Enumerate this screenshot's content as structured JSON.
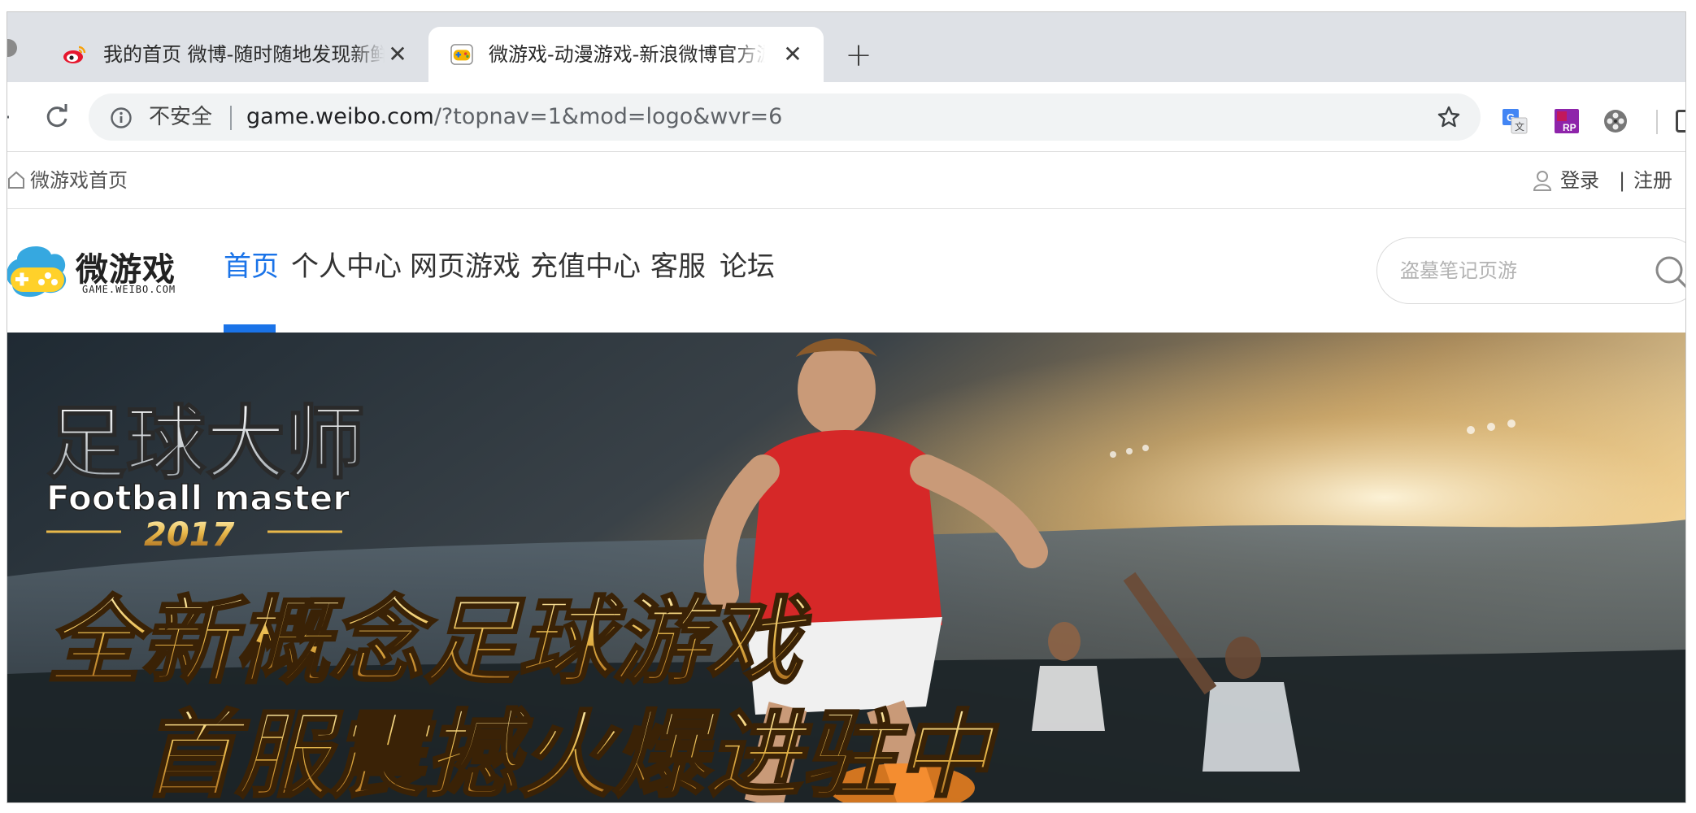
{
  "browser": {
    "tabs": [
      {
        "title": "我的首页 微博-随时随地发现新鲜事",
        "favicon": "weibo-favicon-icon",
        "active": false
      },
      {
        "title": "微游戏-动漫游戏-新浪微博官方游戏平台",
        "favicon": "weibo-game-favicon-icon",
        "active": true
      }
    ],
    "new_tab_symbol": "+",
    "close_symbol": "✕",
    "address": {
      "security_label": "不安全",
      "url_host": "game.weibo.com",
      "url_path": "/?topnav=1&mod=logo&wvr=6"
    },
    "extensions": [
      "translate-extension-icon",
      "rp-extension-icon",
      "film-reel-extension-icon",
      "extension-icon"
    ]
  },
  "topbar": {
    "home_label": "微游戏首页",
    "login_label": "登录",
    "separator": "|",
    "register_label": "注册"
  },
  "logo": {
    "cn": "微游戏",
    "en": "GAME.WEIBO.COM"
  },
  "nav": {
    "items": [
      "首页",
      "个人中心",
      "网页游戏",
      "充值中心",
      "客服",
      "论坛"
    ],
    "active_index": 0
  },
  "search": {
    "placeholder": "盗墓笔记页游",
    "value": ""
  },
  "banner": {
    "game_title_cn": "足球大师",
    "game_title_en": "Football master",
    "year": "2017",
    "slogan_line1": "全新概念足球游戏",
    "slogan_line2": "首服震撼火爆进驻中"
  },
  "colors": {
    "accent": "#1a73e8",
    "tabstrip": "#dee1e6",
    "omnibox": "#f1f3f4",
    "slogan_gold": "#e8b84a"
  }
}
